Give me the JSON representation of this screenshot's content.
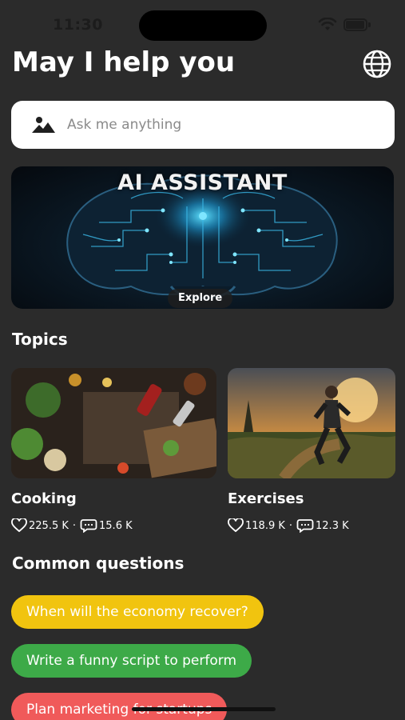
{
  "status": {
    "time": "11:30"
  },
  "header": {
    "title": "May I help you",
    "globe_icon": "globe-icon"
  },
  "search": {
    "placeholder": "Ask me anything",
    "icon": "image-icon"
  },
  "hero": {
    "title": "AI ASSISTANT",
    "explore_label": "Explore"
  },
  "topics": {
    "title": "Topics",
    "items": [
      {
        "name": "Cooking",
        "likes": "225.5 K",
        "comments": "15.6 K"
      },
      {
        "name": "Exercises",
        "likes": "118.9 K",
        "comments": "12.3 K"
      }
    ]
  },
  "common_questions": {
    "title": "Common questions",
    "items": [
      {
        "label": "When will the economy recover?",
        "color": "#f1c40f"
      },
      {
        "label": "Write a funny script to perform",
        "color": "#3daa48"
      },
      {
        "label": "Plan marketing for startups",
        "color": "#f05a5a"
      }
    ]
  }
}
